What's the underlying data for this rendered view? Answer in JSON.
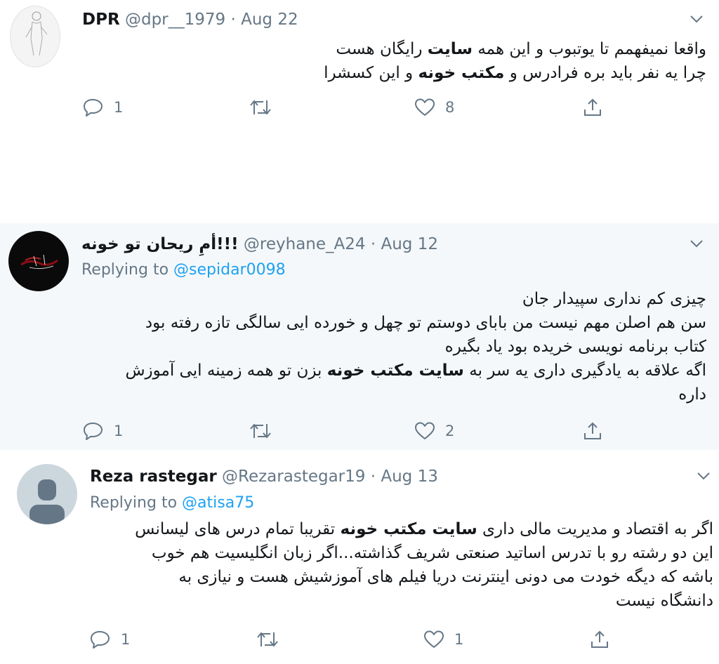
{
  "tweets": [
    {
      "display_name": "DPR",
      "handle": "@dpr__1979",
      "sep": "·",
      "date": "Aug 22",
      "replying_label": "",
      "replying_handle": "",
      "lines": [
        [
          {
            "t": "واقعا نمیفهمم تا یوتبوب و این همه "
          },
          {
            "t": "سایت",
            "b": true
          },
          {
            "t": " رایگان هست"
          }
        ],
        [
          {
            "t": "چرا یه نفر باید بره فرادرس و "
          },
          {
            "t": "مکتب خونه",
            "b": true
          },
          {
            "t": " و این کسشرا"
          }
        ]
      ],
      "reply_count": "1",
      "retweet_count": "",
      "like_count": "8"
    },
    {
      "display_name": "أمِ ریحان تو خونه!!!",
      "handle": "@reyhane_A24",
      "sep": "·",
      "date": "Aug 12",
      "replying_label": "Replying to",
      "replying_handle": "@sepidar0098",
      "lines": [
        [
          {
            "t": "چیزی کم نداری سپیدار جان"
          }
        ],
        [
          {
            "t": "سن هم اصلن مهم نیست من بابای دوستم تو چهل و خورده ایی سالگی تازه رفته بود"
          }
        ],
        [
          {
            "t": "کتاب برنامه نویسی خریده بود یاد بگیره"
          }
        ],
        [
          {
            "t": "اگه علاقه به یادگیری داری یه سر به "
          },
          {
            "t": "سایت مکتب خونه",
            "b": true
          },
          {
            "t": " بزن تو همه زمینه ایی آموزش"
          }
        ],
        [
          {
            "t": "داره"
          }
        ]
      ],
      "reply_count": "1",
      "retweet_count": "",
      "like_count": "2"
    },
    {
      "display_name": "Reza rastegar",
      "handle": "@Rezarastegar19",
      "sep": "·",
      "date": "Aug 13",
      "replying_label": "Replying to",
      "replying_handle": "@atisa75",
      "lines": [
        [
          {
            "t": "اگر به اقتصاد و مدیریت مالی داری "
          },
          {
            "t": "سایت مکتب خونه",
            "b": true
          },
          {
            "t": " تقریبا تمام درس های لیسانس"
          }
        ],
        [
          {
            "t": "این دو رشته رو با تدرس اساتید صنعتی شریف گذاشته...اگر زبان انگلیسیت هم خوب"
          }
        ],
        [
          {
            "t": "باشه که دیگه خودت می دونی اینترنت دریا فیلم های آموزشیش هست و نیازی به"
          }
        ],
        [
          {
            "t": "دانشگاه نیست"
          }
        ]
      ],
      "reply_count": "1",
      "retweet_count": "",
      "like_count": "1"
    }
  ],
  "icons": {
    "reply": "reply-icon",
    "retweet": "retweet-icon",
    "like": "like-icon",
    "share": "share-icon",
    "more": "chevron-down-icon"
  },
  "colors": {
    "text": "#14171a",
    "secondary": "#657786",
    "link": "#1da1f2",
    "highlight_bg": "#f5f8fa"
  }
}
